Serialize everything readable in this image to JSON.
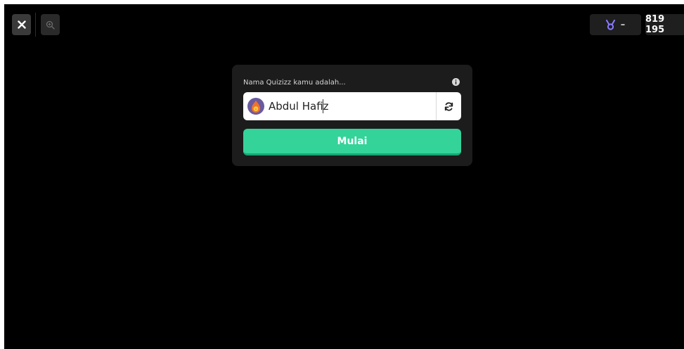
{
  "toolbar": {
    "close_icon": "close-icon",
    "zoom_icon": "zoom-in-icon",
    "medal_icon": "medal-icon",
    "medal_value": "–",
    "game_code": "819 195"
  },
  "join_card": {
    "label": "Nama Quizizz kamu adalah...",
    "info_icon": "info-icon",
    "avatar_icon": "avatar-icon",
    "name_value": "Abdul Hafiz",
    "refresh_icon": "refresh-icon",
    "start_label": "Mulai"
  },
  "colors": {
    "background": "#000000",
    "card": "#1c1c1c",
    "accent": "#34d399",
    "medal": "#8a7cff"
  }
}
